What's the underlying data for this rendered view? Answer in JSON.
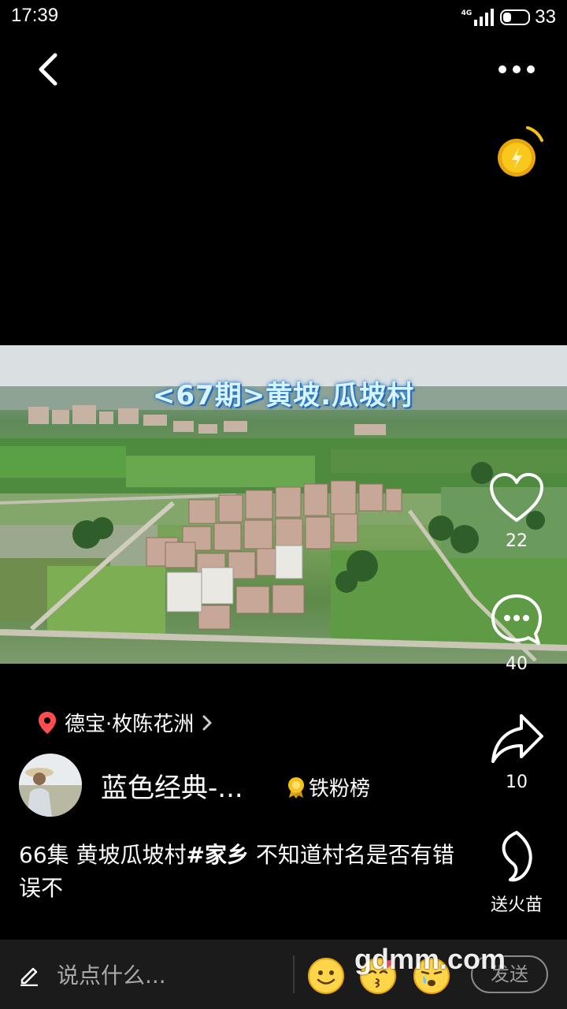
{
  "status_bar": {
    "time": "17:39",
    "network": "4G",
    "battery": "33",
    "battery_level": 0.33
  },
  "video": {
    "title": "<67期>黄坡.瓜坡村"
  },
  "actions": {
    "like_count": "22",
    "comment_count": "40",
    "share_count": "10",
    "gift_label": "送火苗"
  },
  "location": {
    "text": "德宝·枚陈花洲"
  },
  "author": {
    "name": "蓝色经典-...",
    "badge": "铁粉榜"
  },
  "caption": {
    "prefix": "66集 黄坡瓜坡村",
    "hashtag": "#家乡",
    "suffix": " 不知道村名是否有错误不"
  },
  "comment_bar": {
    "placeholder": "说点什么...",
    "send_label": "发送"
  },
  "watermark": "gdmm.com",
  "icons": [
    "back-icon",
    "more-icon",
    "coin-icon",
    "heart-icon",
    "comment-icon",
    "share-icon",
    "flame-icon",
    "location-pin-icon",
    "chevron-right-icon",
    "medal-icon",
    "pencil-icon",
    "smile-emoji-icon",
    "kiss-emoji-icon",
    "cry-emoji-icon"
  ],
  "colors": {
    "accent_gold": "#f6c21a",
    "location_red": "#ff4d4f",
    "background": "#000000"
  }
}
